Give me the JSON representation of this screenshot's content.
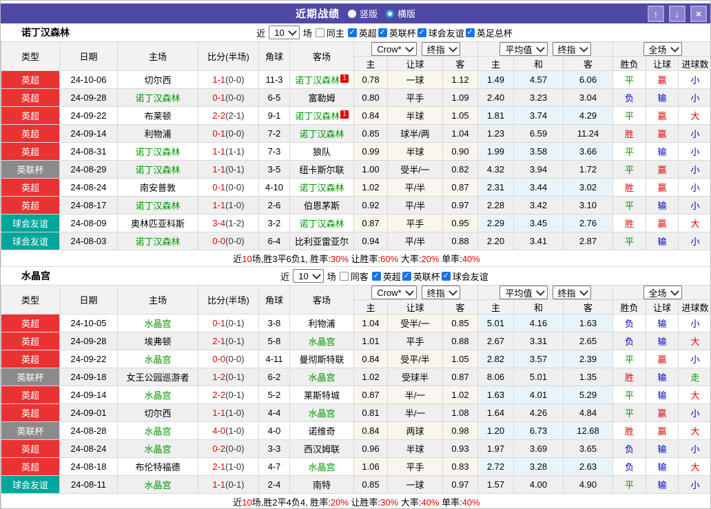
{
  "topbar": {
    "title": "近期战绩",
    "radios": [
      {
        "label": "竖版",
        "selected": false
      },
      {
        "label": "横版",
        "selected": true
      }
    ],
    "buttons": [
      {
        "name": "up",
        "glyph": "↑"
      },
      {
        "name": "down",
        "glyph": "↓"
      },
      {
        "name": "close",
        "glyph": "×"
      }
    ]
  },
  "header": {
    "cols": [
      "类型",
      "日期",
      "主场",
      "比分(半场)",
      "角球",
      "客场"
    ],
    "selects": {
      "company": "Crow*",
      "final1": "终指",
      "average": "平均值",
      "final2": "终指",
      "scope": "全场"
    },
    "sub": [
      "主",
      "让球",
      "客",
      "主",
      "和",
      "客",
      "胜负",
      "让球",
      "进球数"
    ]
  },
  "colors": {
    "league": {
      "英超": "#ea3232",
      "英联杯": "#8b8b8b",
      "球会友谊": "#00a69a"
    },
    "result": {
      "r": "#e60000",
      "g": "#009700",
      "b": "#0000cb"
    },
    "team_self": "#009700",
    "topbar_bg": "#4f49a5"
  },
  "sections": [
    {
      "team": "诺丁汉森林",
      "filter": {
        "near": "近",
        "count": "10",
        "match": "场",
        "same": {
          "label": "同主",
          "checked": false
        },
        "leagues": [
          "英超",
          "英联杯",
          "球会友谊",
          "英足总杯"
        ]
      },
      "rows": [
        {
          "league": "英超",
          "date": "24-10-06",
          "home": {
            "name": "切尔西",
            "self": false,
            "card": ""
          },
          "score": "1-1",
          "half": "(0-0)",
          "corner": "11-3",
          "away": {
            "name": "诺丁汉森林",
            "self": true,
            "card": "1"
          },
          "let": [
            "0.78",
            "一球",
            "1.12"
          ],
          "avg": [
            "1.49",
            "4.57",
            "6.06"
          ],
          "res": [
            {
              "text": "平",
              "color": "g"
            },
            {
              "text": "赢",
              "color": "r"
            },
            {
              "text": "小",
              "color": "b"
            }
          ]
        },
        {
          "league": "英超",
          "date": "24-09-28",
          "home": {
            "name": "诺丁汉森林",
            "self": true,
            "card": ""
          },
          "score": "0-1",
          "half": "(0-0)",
          "corner": "6-5",
          "away": {
            "name": "富勒姆",
            "self": false,
            "card": ""
          },
          "let": [
            "0.80",
            "平手",
            "1.09"
          ],
          "avg": [
            "2.40",
            "3.23",
            "3.04"
          ],
          "res": [
            {
              "text": "负",
              "color": "b"
            },
            {
              "text": "输",
              "color": "b"
            },
            {
              "text": "小",
              "color": "b"
            }
          ]
        },
        {
          "league": "英超",
          "date": "24-09-22",
          "home": {
            "name": "布莱顿",
            "self": false,
            "card": ""
          },
          "score": "2-2",
          "half": "(2-1)",
          "corner": "9-1",
          "away": {
            "name": "诺丁汉森林",
            "self": true,
            "card": "1"
          },
          "let": [
            "0.84",
            "半球",
            "1.05"
          ],
          "avg": [
            "1.81",
            "3.74",
            "4.29"
          ],
          "res": [
            {
              "text": "平",
              "color": "g"
            },
            {
              "text": "赢",
              "color": "r"
            },
            {
              "text": "大",
              "color": "r"
            }
          ]
        },
        {
          "league": "英超",
          "date": "24-09-14",
          "home": {
            "name": "利物浦",
            "self": false,
            "card": ""
          },
          "score": "0-1",
          "half": "(0-0)",
          "corner": "7-2",
          "away": {
            "name": "诺丁汉森林",
            "self": true,
            "card": ""
          },
          "let": [
            "0.85",
            "球半/两",
            "1.04"
          ],
          "avg": [
            "1.23",
            "6.59",
            "11.24"
          ],
          "res": [
            {
              "text": "胜",
              "color": "r"
            },
            {
              "text": "赢",
              "color": "r"
            },
            {
              "text": "小",
              "color": "b"
            }
          ]
        },
        {
          "league": "英超",
          "date": "24-08-31",
          "home": {
            "name": "诺丁汉森林",
            "self": true,
            "card": ""
          },
          "score": "1-1",
          "half": "(1-1)",
          "corner": "7-3",
          "away": {
            "name": "狼队",
            "self": false,
            "card": ""
          },
          "let": [
            "0.99",
            "半球",
            "0.90"
          ],
          "avg": [
            "1.99",
            "3.58",
            "3.66"
          ],
          "res": [
            {
              "text": "平",
              "color": "g"
            },
            {
              "text": "输",
              "color": "b"
            },
            {
              "text": "小",
              "color": "b"
            }
          ]
        },
        {
          "league": "英联杯",
          "date": "24-08-29",
          "home": {
            "name": "诺丁汉森林",
            "self": true,
            "card": ""
          },
          "score": "1-1",
          "half": "(0-1)",
          "corner": "3-5",
          "away": {
            "name": "纽卡斯尔联",
            "self": false,
            "card": ""
          },
          "let": [
            "1.00",
            "受半/一",
            "0.82"
          ],
          "avg": [
            "4.32",
            "3.94",
            "1.72"
          ],
          "res": [
            {
              "text": "平",
              "color": "g"
            },
            {
              "text": "赢",
              "color": "r"
            },
            {
              "text": "小",
              "color": "b"
            }
          ]
        },
        {
          "league": "英超",
          "date": "24-08-24",
          "home": {
            "name": "南安普敦",
            "self": false,
            "card": ""
          },
          "score": "0-1",
          "half": "(0-0)",
          "corner": "4-10",
          "away": {
            "name": "诺丁汉森林",
            "self": true,
            "card": ""
          },
          "let": [
            "1.02",
            "平/半",
            "0.87"
          ],
          "avg": [
            "2.31",
            "3.44",
            "3.02"
          ],
          "res": [
            {
              "text": "胜",
              "color": "r"
            },
            {
              "text": "赢",
              "color": "r"
            },
            {
              "text": "小",
              "color": "b"
            }
          ]
        },
        {
          "league": "英超",
          "date": "24-08-17",
          "home": {
            "name": "诺丁汉森林",
            "self": true,
            "card": ""
          },
          "score": "1-1",
          "half": "(1-0)",
          "corner": "2-6",
          "away": {
            "name": "伯恩茅斯",
            "self": false,
            "card": ""
          },
          "let": [
            "0.92",
            "平/半",
            "0.97"
          ],
          "avg": [
            "2.28",
            "3.42",
            "3.10"
          ],
          "res": [
            {
              "text": "平",
              "color": "g"
            },
            {
              "text": "输",
              "color": "b"
            },
            {
              "text": "小",
              "color": "b"
            }
          ]
        },
        {
          "league": "球会友谊",
          "date": "24-08-09",
          "home": {
            "name": "奥林匹亚科斯",
            "self": false,
            "card": ""
          },
          "score": "3-4",
          "half": "(1-2)",
          "corner": "3-2",
          "away": {
            "name": "诺丁汉森林",
            "self": true,
            "card": ""
          },
          "let": [
            "0.87",
            "平手",
            "0.95"
          ],
          "avg": [
            "2.29",
            "3.45",
            "2.76"
          ],
          "res": [
            {
              "text": "胜",
              "color": "r"
            },
            {
              "text": "赢",
              "color": "r"
            },
            {
              "text": "大",
              "color": "r"
            }
          ]
        },
        {
          "league": "球会友谊",
          "date": "24-08-03",
          "home": {
            "name": "诺丁汉森林",
            "self": true,
            "card": ""
          },
          "score": "0-0",
          "half": "(0-0)",
          "corner": "6-4",
          "away": {
            "name": "比利亚雷亚尔",
            "self": false,
            "card": ""
          },
          "let": [
            "0.94",
            "平/半",
            "0.88"
          ],
          "avg": [
            "2.20",
            "3.41",
            "2.87"
          ],
          "res": [
            {
              "text": "平",
              "color": "g"
            },
            {
              "text": "输",
              "color": "b"
            },
            {
              "text": "小",
              "color": "b"
            }
          ]
        }
      ],
      "summary": [
        {
          "text": "近",
          "red": false
        },
        {
          "text": "10",
          "red": true
        },
        {
          "text": "场,胜3平6负1, 胜率:",
          "red": false
        },
        {
          "text": "30%",
          "red": true
        },
        {
          "text": " 让胜率:",
          "red": false
        },
        {
          "text": "60%",
          "red": true
        },
        {
          "text": " 大率:",
          "red": false
        },
        {
          "text": "20%",
          "red": true
        },
        {
          "text": " 单率:",
          "red": false
        },
        {
          "text": "40%",
          "red": true
        }
      ]
    },
    {
      "team": "水晶宫",
      "filter": {
        "near": "近",
        "count": "10",
        "match": "场",
        "same": {
          "label": "同客",
          "checked": false
        },
        "leagues": [
          "英超",
          "英联杯",
          "球会友谊"
        ]
      },
      "rows": [
        {
          "league": "英超",
          "date": "24-10-05",
          "home": {
            "name": "水晶宫",
            "self": true,
            "card": ""
          },
          "score": "0-1",
          "half": "(0-1)",
          "corner": "3-8",
          "away": {
            "name": "利物浦",
            "self": false,
            "card": ""
          },
          "let": [
            "1.04",
            "受半/一",
            "0.85"
          ],
          "avg": [
            "5.01",
            "4.16",
            "1.63"
          ],
          "res": [
            {
              "text": "负",
              "color": "b"
            },
            {
              "text": "输",
              "color": "b"
            },
            {
              "text": "小",
              "color": "b"
            }
          ]
        },
        {
          "league": "英超",
          "date": "24-09-28",
          "home": {
            "name": "埃弗顿",
            "self": false,
            "card": ""
          },
          "score": "2-1",
          "half": "(0-1)",
          "corner": "5-8",
          "away": {
            "name": "水晶宫",
            "self": true,
            "card": ""
          },
          "let": [
            "1.01",
            "平手",
            "0.88"
          ],
          "avg": [
            "2.67",
            "3.31",
            "2.65"
          ],
          "res": [
            {
              "text": "负",
              "color": "b"
            },
            {
              "text": "输",
              "color": "b"
            },
            {
              "text": "大",
              "color": "r"
            }
          ]
        },
        {
          "league": "英超",
          "date": "24-09-22",
          "home": {
            "name": "水晶宫",
            "self": true,
            "card": ""
          },
          "score": "0-0",
          "half": "(0-0)",
          "corner": "4-11",
          "away": {
            "name": "曼彻斯特联",
            "self": false,
            "card": ""
          },
          "let": [
            "0.84",
            "受平/半",
            "1.05"
          ],
          "avg": [
            "2.82",
            "3.57",
            "2.39"
          ],
          "res": [
            {
              "text": "平",
              "color": "g"
            },
            {
              "text": "赢",
              "color": "r"
            },
            {
              "text": "小",
              "color": "b"
            }
          ]
        },
        {
          "league": "英联杯",
          "date": "24-09-18",
          "home": {
            "name": "女王公园巡游者",
            "self": false,
            "card": ""
          },
          "score": "1-2",
          "half": "(0-1)",
          "corner": "6-2",
          "away": {
            "name": "水晶宫",
            "self": true,
            "card": ""
          },
          "let": [
            "1.02",
            "受球半",
            "0.87"
          ],
          "avg": [
            "8.06",
            "5.01",
            "1.35"
          ],
          "res": [
            {
              "text": "胜",
              "color": "r"
            },
            {
              "text": "输",
              "color": "b"
            },
            {
              "text": "走",
              "color": "g"
            }
          ]
        },
        {
          "league": "英超",
          "date": "24-09-14",
          "home": {
            "name": "水晶宫",
            "self": true,
            "card": ""
          },
          "score": "2-2",
          "half": "(0-1)",
          "corner": "5-2",
          "away": {
            "name": "莱斯特城",
            "self": false,
            "card": ""
          },
          "let": [
            "0.87",
            "半/一",
            "1.02"
          ],
          "avg": [
            "1.63",
            "4.01",
            "5.29"
          ],
          "res": [
            {
              "text": "平",
              "color": "g"
            },
            {
              "text": "输",
              "color": "b"
            },
            {
              "text": "大",
              "color": "r"
            }
          ]
        },
        {
          "league": "英超",
          "date": "24-09-01",
          "home": {
            "name": "切尔西",
            "self": false,
            "card": ""
          },
          "score": "1-1",
          "half": "(1-0)",
          "corner": "4-4",
          "away": {
            "name": "水晶宫",
            "self": true,
            "card": ""
          },
          "let": [
            "0.81",
            "半/一",
            "1.08"
          ],
          "avg": [
            "1.64",
            "4.26",
            "4.84"
          ],
          "res": [
            {
              "text": "平",
              "color": "g"
            },
            {
              "text": "赢",
              "color": "r"
            },
            {
              "text": "小",
              "color": "b"
            }
          ]
        },
        {
          "league": "英联杯",
          "date": "24-08-28",
          "home": {
            "name": "水晶宫",
            "self": true,
            "card": ""
          },
          "score": "4-0",
          "half": "(1-0)",
          "corner": "4-0",
          "away": {
            "name": "诺维奇",
            "self": false,
            "card": ""
          },
          "let": [
            "0.84",
            "两球",
            "0.98"
          ],
          "avg": [
            "1.20",
            "6.73",
            "12.68"
          ],
          "res": [
            {
              "text": "胜",
              "color": "r"
            },
            {
              "text": "赢",
              "color": "r"
            },
            {
              "text": "大",
              "color": "r"
            }
          ]
        },
        {
          "league": "英超",
          "date": "24-08-24",
          "home": {
            "name": "水晶宫",
            "self": true,
            "card": ""
          },
          "score": "0-2",
          "half": "(0-0)",
          "corner": "3-3",
          "away": {
            "name": "西汉姆联",
            "self": false,
            "card": ""
          },
          "let": [
            "0.96",
            "半球",
            "0.93"
          ],
          "avg": [
            "1.97",
            "3.69",
            "3.65"
          ],
          "res": [
            {
              "text": "负",
              "color": "b"
            },
            {
              "text": "输",
              "color": "b"
            },
            {
              "text": "小",
              "color": "b"
            }
          ]
        },
        {
          "league": "英超",
          "date": "24-08-18",
          "home": {
            "name": "布伦特福德",
            "self": false,
            "card": ""
          },
          "score": "2-1",
          "half": "(1-0)",
          "corner": "4-7",
          "away": {
            "name": "水晶宫",
            "self": true,
            "card": ""
          },
          "let": [
            "1.06",
            "平手",
            "0.83"
          ],
          "avg": [
            "2.72",
            "3.28",
            "2.63"
          ],
          "res": [
            {
              "text": "负",
              "color": "b"
            },
            {
              "text": "输",
              "color": "b"
            },
            {
              "text": "大",
              "color": "r"
            }
          ]
        },
        {
          "league": "球会友谊",
          "date": "24-08-11",
          "home": {
            "name": "水晶宫",
            "self": true,
            "card": ""
          },
          "score": "1-1",
          "half": "(0-1)",
          "corner": "2-4",
          "away": {
            "name": "南特",
            "self": false,
            "card": ""
          },
          "let": [
            "0.85",
            "一球",
            "0.97"
          ],
          "avg": [
            "1.57",
            "4.00",
            "4.90"
          ],
          "res": [
            {
              "text": "平",
              "color": "g"
            },
            {
              "text": "输",
              "color": "b"
            },
            {
              "text": "小",
              "color": "b"
            }
          ]
        }
      ],
      "summary": [
        {
          "text": "近",
          "red": false
        },
        {
          "text": "10",
          "red": true
        },
        {
          "text": "场,胜2平4负4, 胜率:",
          "red": false
        },
        {
          "text": "20%",
          "red": true
        },
        {
          "text": " 让胜率:",
          "red": false
        },
        {
          "text": "30%",
          "red": true
        },
        {
          "text": " 大率:",
          "red": false
        },
        {
          "text": "40%",
          "red": true
        },
        {
          "text": " 单率:",
          "red": false
        },
        {
          "text": "40%",
          "red": true
        }
      ]
    }
  ]
}
